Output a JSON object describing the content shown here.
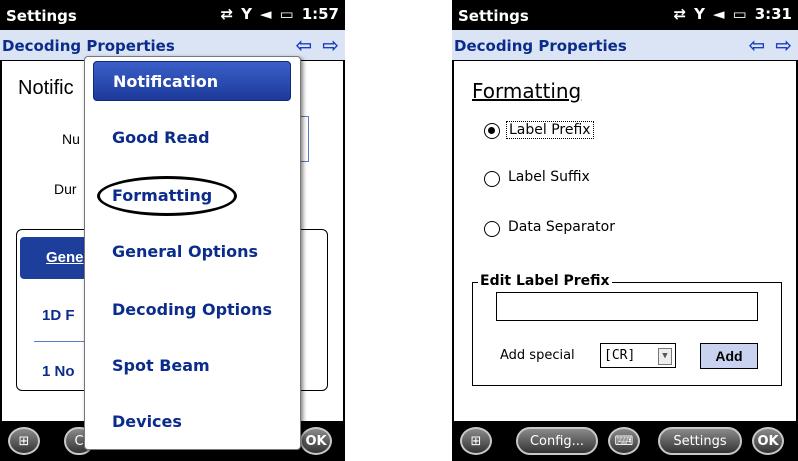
{
  "left_screen": {
    "status": {
      "title": "Settings",
      "time": "1:57"
    },
    "app_title": "Decoding Properties",
    "nav": {
      "back": "⇦",
      "forward": "⇨"
    },
    "heading": "Notific",
    "labels": {
      "number": "Nu",
      "duration": "Dur"
    },
    "tab_partial": "Gene",
    "rows": [
      "1D F",
      "1 No"
    ],
    "menu": [
      "Notification",
      "Good Read",
      "Formatting",
      "General Options",
      "Decoding Options",
      "Spot Beam",
      "Devices"
    ],
    "bottom": {
      "ok": "OK",
      "partial": "C"
    }
  },
  "right_screen": {
    "status": {
      "title": "Settings",
      "time": "3:31"
    },
    "app_title": "Decoding Properties",
    "nav": {
      "back": "⇦",
      "forward": "⇨"
    },
    "heading": "Formatting",
    "options": [
      "Label Prefix",
      "Label Suffix",
      "Data Separator"
    ],
    "selected_option": "Label Prefix",
    "group_title": "Edit Label Prefix",
    "edit_value": "",
    "add_special_label": "Add special",
    "combo_value": "[CR]",
    "add_button": "Add",
    "bottom": {
      "config": "Config...",
      "settings": "Settings",
      "ok": "OK"
    }
  }
}
